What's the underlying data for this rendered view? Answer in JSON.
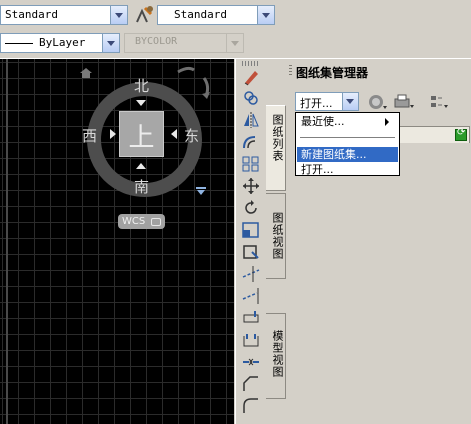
{
  "toolbar": {
    "text_style": "Standard",
    "dim_style": "Standard",
    "linetype": "ByLayer",
    "color": "BYCOLOR"
  },
  "viewcube": {
    "north": "北",
    "south": "南",
    "east": "东",
    "west": "西",
    "face": "上",
    "wcs_label": "WCS"
  },
  "sheetset": {
    "title": "图纸集管理器",
    "open_dropdown": "打开...",
    "tabs": [
      "图纸列表",
      "图纸视图",
      "模型视图"
    ],
    "menu": {
      "recent": "最近使...",
      "new_set": "新建图纸集...",
      "open": "打开..."
    }
  },
  "colors": {
    "canvas": "#000000",
    "grid": "#2b2b2b",
    "selection": "#316ac5",
    "panel": "#d4d0c8"
  }
}
